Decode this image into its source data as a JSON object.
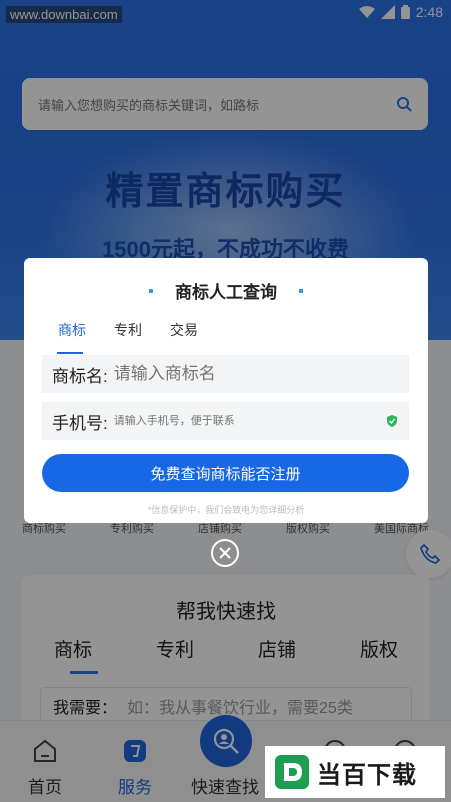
{
  "status_bar": {
    "watermark": "www.downbai.com",
    "time": "2:48"
  },
  "search": {
    "placeholder": "请输入您想购买的商标关键词，如路标"
  },
  "hero": {
    "title": "精置商标购买",
    "subtitle": "1500元起，不成功不收费"
  },
  "categories": [
    "商标购买",
    "专利购买",
    "店铺购买",
    "版权购买",
    "美国际商标"
  ],
  "quick_find": {
    "title": "帮我快速找",
    "tabs": [
      "商标",
      "专利",
      "店铺",
      "版权"
    ],
    "need_label": "我需要：",
    "need_placeholder": "如：我从事餐饮行业，需要25类"
  },
  "tabbar": {
    "items": [
      {
        "label": "首页"
      },
      {
        "label": "服务"
      },
      {
        "label": "快速查找"
      }
    ]
  },
  "modal": {
    "title": "商标人工查询",
    "tabs": [
      "商标",
      "专利",
      "交易"
    ],
    "name_label": "商标名:",
    "name_placeholder": "请输入商标名",
    "phone_label": "手机号:",
    "phone_placeholder": "请输入手机号，便于联系",
    "submit_label": "免费查询商标能否注册",
    "privacy_note": "*信息保护中，我们会致电为您详细分析"
  },
  "brand": {
    "text": "当百下载"
  },
  "colors": {
    "primary": "#1f64dc",
    "hero_blue": "#2b73e8"
  }
}
